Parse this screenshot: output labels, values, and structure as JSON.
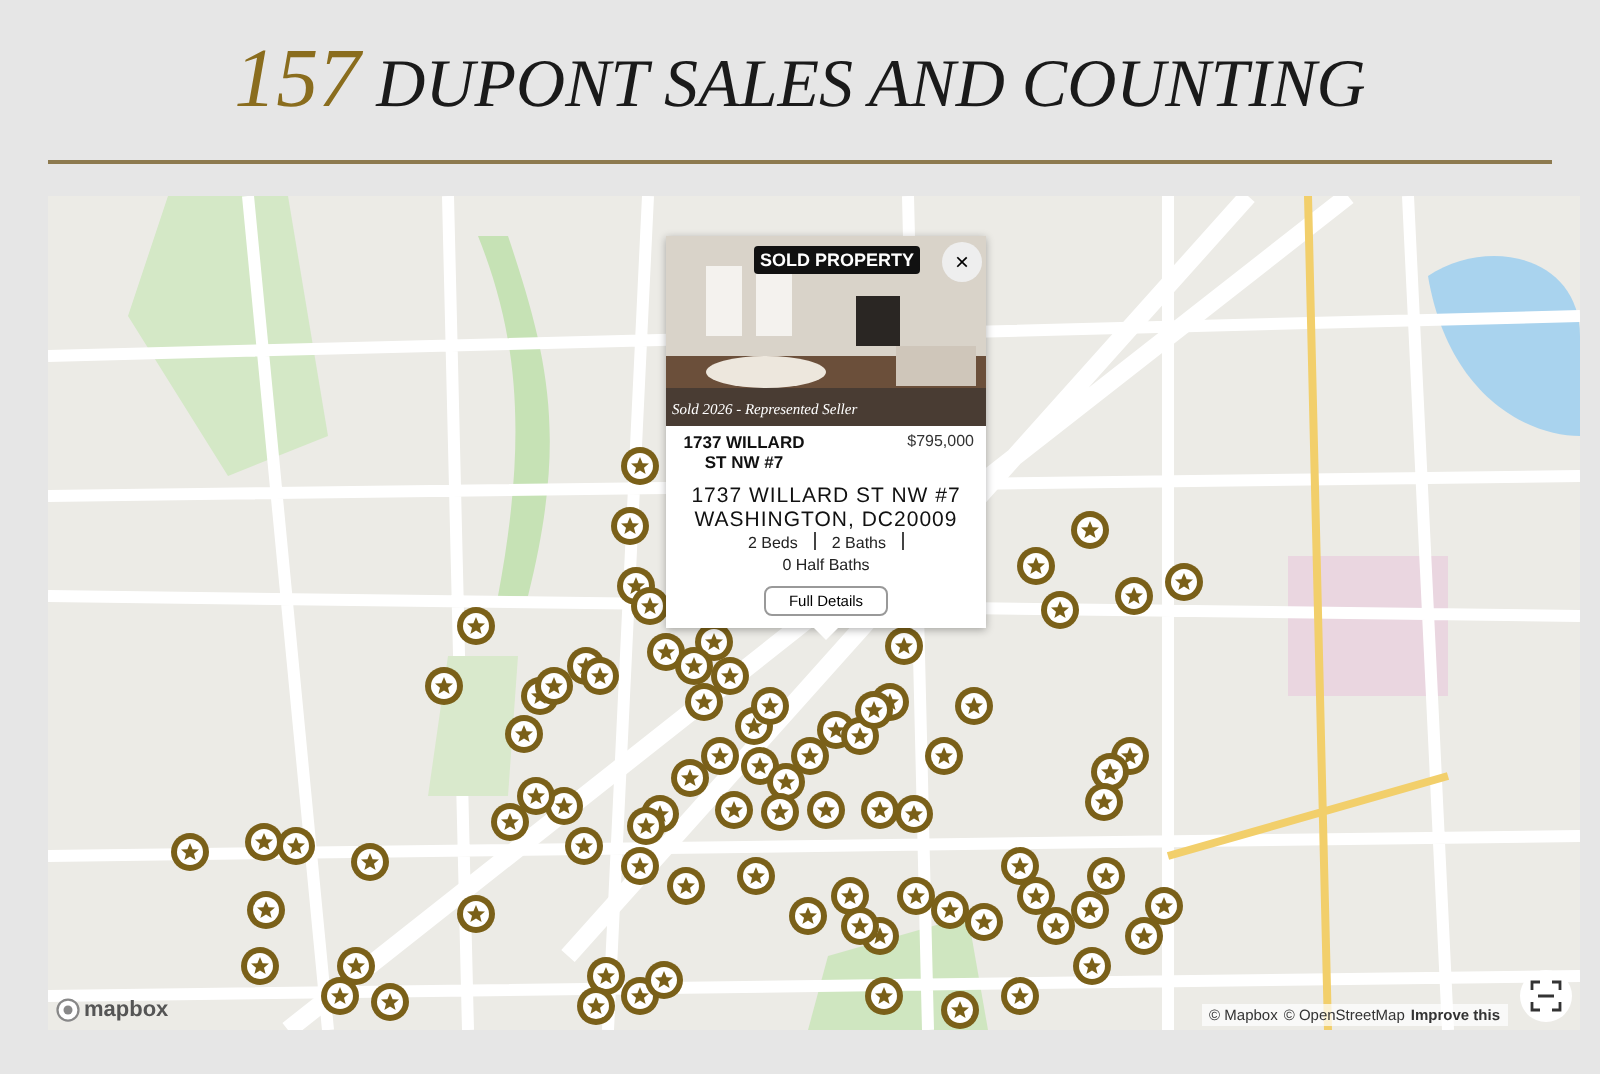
{
  "heading": {
    "count": "157",
    "title": "DUPONT SALES AND COUNTING"
  },
  "map": {
    "popup": {
      "badge": "SOLD PROPERTY",
      "close": "×",
      "caption": "Sold 2026 - Represented Seller",
      "short_address": "1737 WILLARD ST NW #7",
      "price": "$795,000",
      "address_line1": "1737 WILLARD ST NW #7",
      "address_line2": "WASHINGTON, DC20009",
      "beds": "2 Beds",
      "baths": "2 Baths",
      "half_baths": "0 Half Baths",
      "button": "Full Details"
    },
    "logo": "mapbox",
    "attribution": [
      "© Mapbox",
      "© OpenStreetMap",
      "Improve this"
    ]
  }
}
